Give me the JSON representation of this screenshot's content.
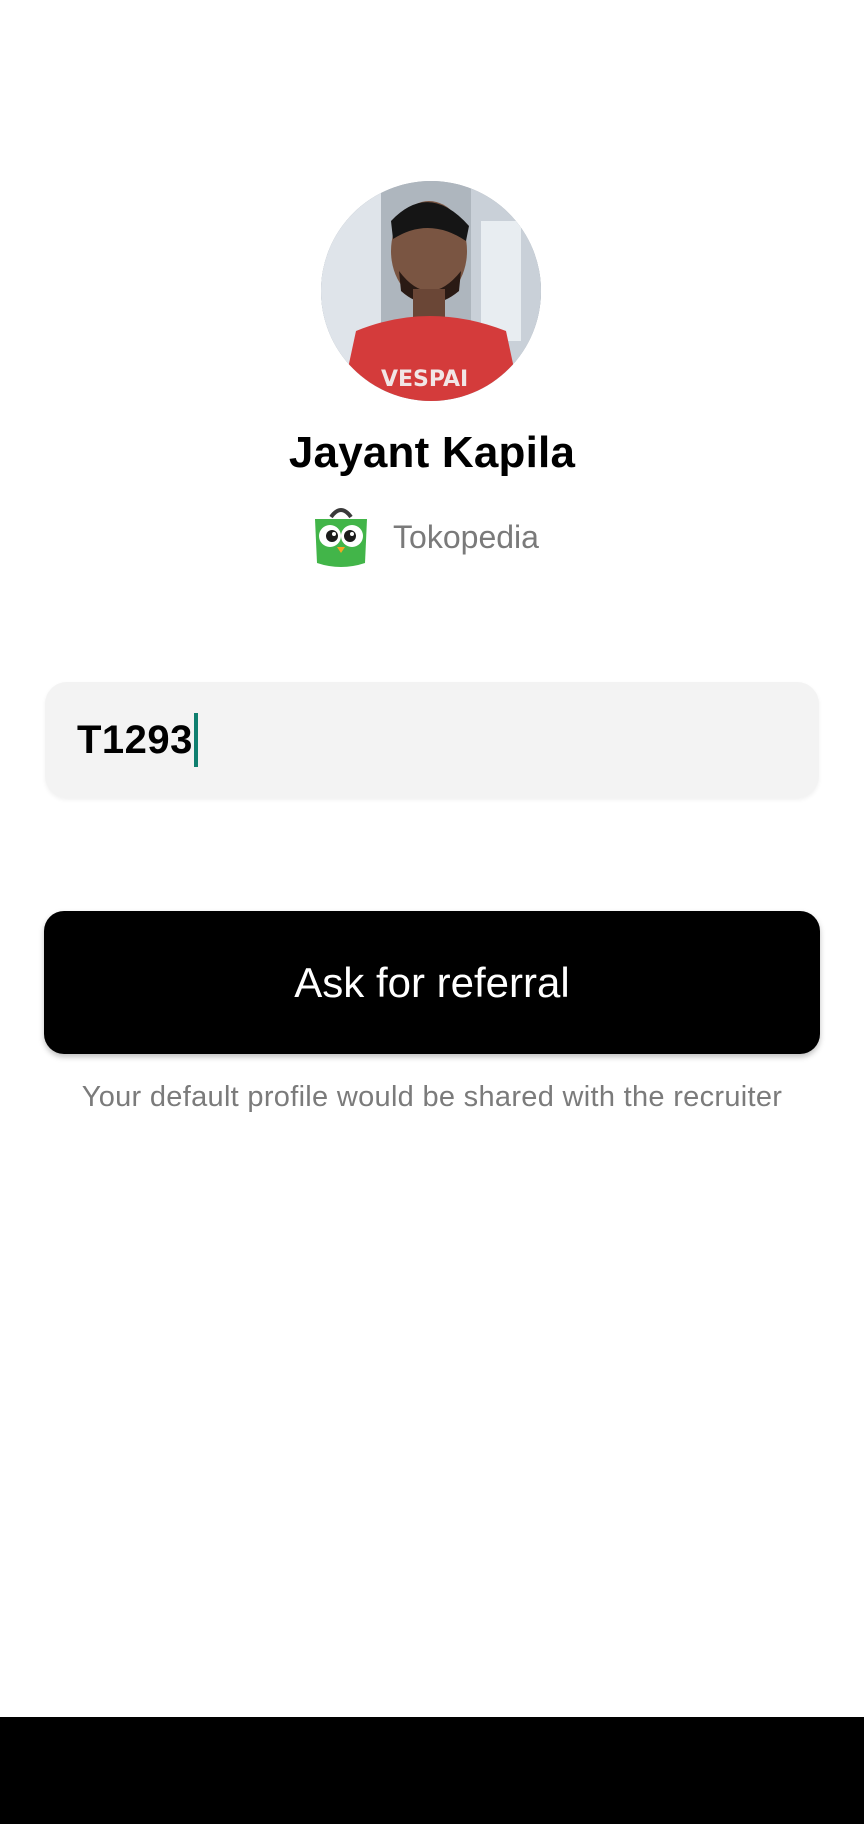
{
  "profile": {
    "name": "Jayant Kapila",
    "avatar_icon": "profile-photo"
  },
  "company": {
    "name": "Tokopedia",
    "logo_icon": "tokopedia-owl-bag-icon",
    "logo_color": "#42b549"
  },
  "referral_code": {
    "value": "T1293",
    "placeholder": ""
  },
  "actions": {
    "ask_referral_label": "Ask for referral"
  },
  "helper": {
    "text": "Your default profile would be shared with the recruiter"
  },
  "colors": {
    "button_bg": "#000000",
    "field_bg": "#f3f3f3",
    "caret": "#0f7f6f",
    "nav_bar": "#000000"
  }
}
